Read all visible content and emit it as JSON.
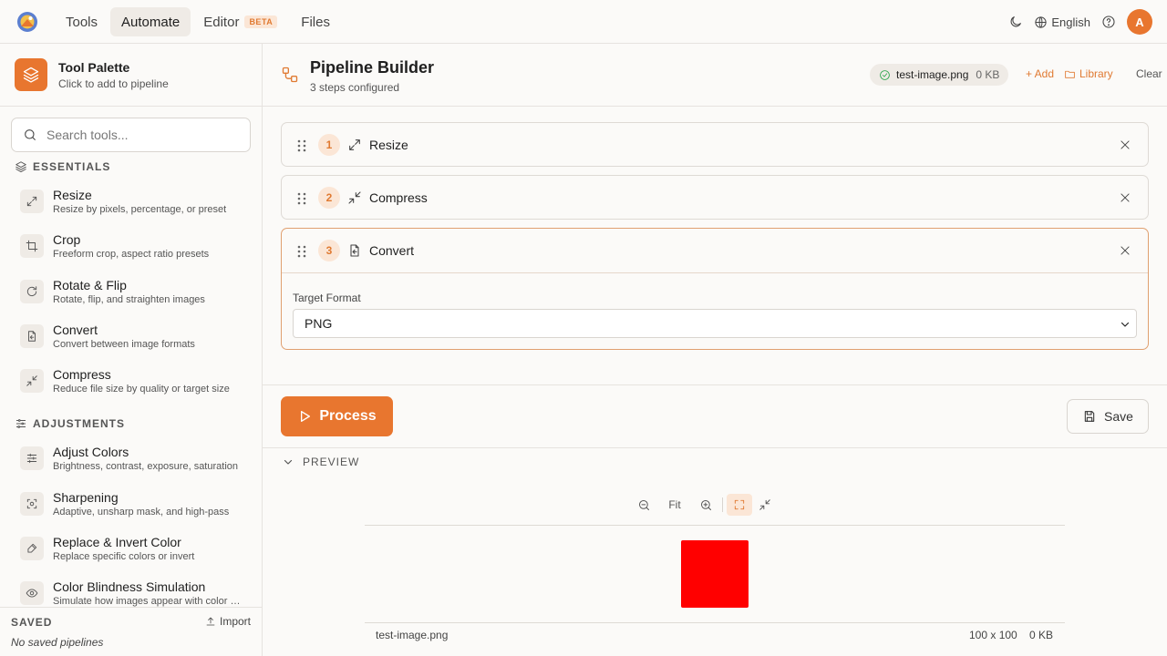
{
  "nav": {
    "tabs": [
      {
        "label": "Tools"
      },
      {
        "label": "Automate"
      },
      {
        "label": "Editor",
        "badge": "BETA"
      },
      {
        "label": "Files"
      }
    ],
    "language": "English",
    "avatar_initial": "A"
  },
  "sidebar": {
    "title": "Tool Palette",
    "subtitle": "Click to add to pipeline",
    "search_placeholder": "Search tools...",
    "sections": [
      {
        "label": "ESSENTIALS",
        "tools": [
          {
            "name": "Resize",
            "desc": "Resize by pixels, percentage, or preset",
            "icon": "expand-icon"
          },
          {
            "name": "Crop",
            "desc": "Freeform crop, aspect ratio presets",
            "icon": "crop-icon"
          },
          {
            "name": "Rotate & Flip",
            "desc": "Rotate, flip, and straighten images",
            "icon": "rotate-icon"
          },
          {
            "name": "Convert",
            "desc": "Convert between image formats",
            "icon": "file-convert-icon"
          },
          {
            "name": "Compress",
            "desc": "Reduce file size by quality or target size",
            "icon": "compress-icon"
          }
        ]
      },
      {
        "label": "ADJUSTMENTS",
        "tools": [
          {
            "name": "Adjust Colors",
            "desc": "Brightness, contrast, exposure, saturation",
            "icon": "sliders-icon"
          },
          {
            "name": "Sharpening",
            "desc": "Adaptive, unsharp mask, and high-pass",
            "icon": "focus-icon"
          },
          {
            "name": "Replace & Invert Color",
            "desc": "Replace specific colors or invert",
            "icon": "eyedropper-icon"
          },
          {
            "name": "Color Blindness Simulation",
            "desc": "Simulate how images appear with color blindness",
            "icon": "eye-icon"
          }
        ]
      }
    ],
    "saved": {
      "label": "SAVED",
      "import_label": "Import",
      "empty": "No saved pipelines"
    }
  },
  "pipeline": {
    "title": "Pipeline Builder",
    "subtitle": "3 steps configured",
    "file": {
      "name": "test-image.png",
      "size": "0 KB"
    },
    "add_label": "+ Add",
    "library_label": "Library",
    "clear_label": "Clear",
    "steps": [
      {
        "num": "1",
        "name": "Resize"
      },
      {
        "num": "2",
        "name": "Compress"
      },
      {
        "num": "3",
        "name": "Convert",
        "field_label": "Target Format",
        "field_value": "PNG"
      }
    ],
    "process_label": "Process",
    "save_label": "Save"
  },
  "preview": {
    "label": "PREVIEW",
    "fit_label": "Fit",
    "file_name": "test-image.png",
    "dimensions": "100 x 100",
    "size": "0 KB",
    "image_color": "#ff0000"
  },
  "colors": {
    "accent": "#e8762f"
  }
}
